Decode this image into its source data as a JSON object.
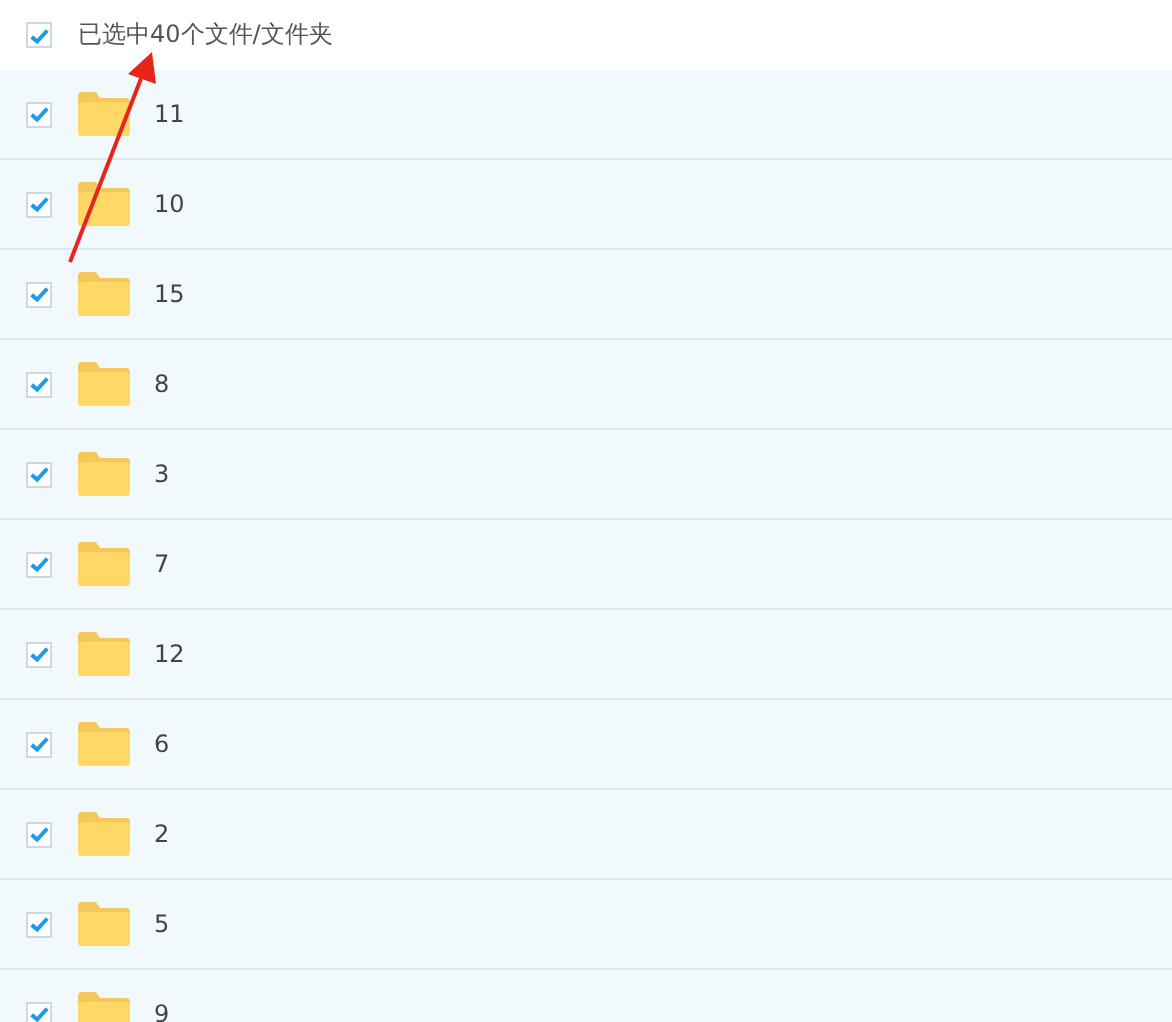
{
  "header": {
    "checked": true,
    "label": "已选中40个文件/文件夹"
  },
  "rows": [
    {
      "name": "11",
      "checked": true
    },
    {
      "name": "10",
      "checked": true
    },
    {
      "name": "15",
      "checked": true
    },
    {
      "name": "8",
      "checked": true
    },
    {
      "name": "3",
      "checked": true
    },
    {
      "name": "7",
      "checked": true
    },
    {
      "name": "12",
      "checked": true
    },
    {
      "name": "6",
      "checked": true
    },
    {
      "name": "2",
      "checked": true
    },
    {
      "name": "5",
      "checked": true
    },
    {
      "name": "9",
      "checked": true
    }
  ]
}
